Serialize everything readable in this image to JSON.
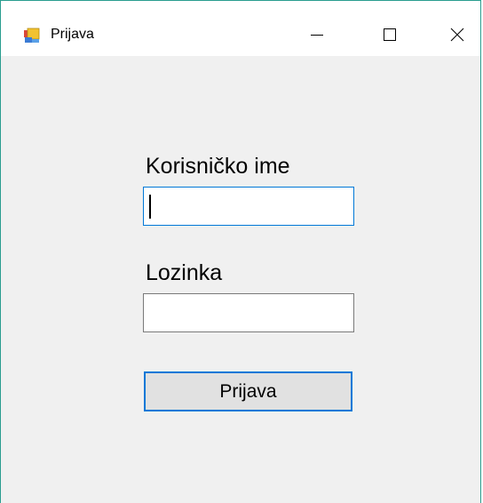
{
  "window": {
    "title": "Prijava",
    "controls": {
      "minimize_icon": "minimize-icon",
      "maximize_icon": "maximize-icon",
      "close_icon": "close-icon"
    }
  },
  "form": {
    "username_label": "Korisničko ime",
    "username_value": "",
    "password_label": "Lozinka",
    "password_value": "",
    "submit_label": "Prijava"
  },
  "colors": {
    "accent": "#0078d7",
    "window_bg": "#f0f0f0",
    "titlebar_bg": "#ffffff",
    "window_border": "#2a9d8f"
  }
}
